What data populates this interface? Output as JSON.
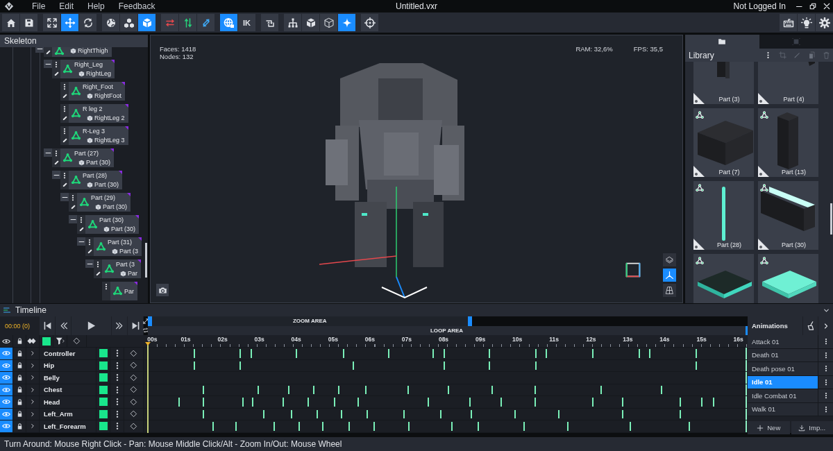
{
  "window": {
    "title": "Untitled.vxr",
    "menu": [
      "File",
      "Edit",
      "Help",
      "Feedback"
    ],
    "account": "Not Logged In"
  },
  "toolbar": {
    "groups": [
      [
        {
          "kind": "home",
          "selected": false
        },
        {
          "kind": "save",
          "selected": false
        }
      ],
      [
        {
          "kind": "fit",
          "selected": false
        },
        {
          "kind": "move",
          "selected": true
        },
        {
          "kind": "rotate",
          "selected": false
        }
      ],
      [
        {
          "kind": "globe",
          "selected": false
        },
        {
          "kind": "nodes",
          "selected": false
        },
        {
          "kind": "cube",
          "selected": true
        }
      ],
      [
        {
          "kind": "swap",
          "selected": false
        },
        {
          "kind": "updown",
          "selected": false
        },
        {
          "kind": "swapdiag",
          "selected": false
        }
      ],
      [
        {
          "kind": "globelink",
          "selected": true
        },
        {
          "kind": "text",
          "label": "IK",
          "selected": false
        }
      ],
      [
        {
          "kind": "rotatebox",
          "selected": false
        }
      ],
      [
        {
          "kind": "hierarchy",
          "selected": false
        },
        {
          "kind": "cubesolid",
          "selected": false
        },
        {
          "kind": "cubeoutline",
          "selected": false
        },
        {
          "kind": "sparkle",
          "selected": true
        }
      ],
      [
        {
          "kind": "crosshair",
          "selected": false
        }
      ]
    ],
    "right": [
      {
        "kind": "keyboard"
      },
      {
        "kind": "bulb"
      },
      {
        "kind": "gear"
      }
    ]
  },
  "skeleton": {
    "title": "Skeleton",
    "nodes": [
      {
        "mesh": "RightThigh",
        "expanded": true,
        "children": [
          {
            "name": "Right_Leg",
            "mesh": "RightLeg",
            "expanded": true,
            "children": [
              {
                "name": "Right_Foot",
                "mesh": "RightFoot"
              },
              {
                "name": "R leg 2",
                "mesh": "RightLeg 2"
              },
              {
                "name": "R-Leg 3",
                "mesh": "RightLeg 3"
              }
            ]
          },
          {
            "name": "Part (27)",
            "mesh": "Part (30)",
            "expanded": true,
            "children": [
              {
                "name": "Part (28)",
                "mesh": "Part (30)",
                "expanded": true,
                "children": [
                  {
                    "name": "Part (29)",
                    "mesh": "Part (30)",
                    "expanded": true,
                    "children": [
                      {
                        "name": "Part (30)",
                        "mesh": "Part (30)",
                        "expanded": true,
                        "children": [
                          {
                            "name": "Part (31)",
                            "mesh": "Part (3",
                            "expanded": true,
                            "children": [
                              {
                                "name": "Part (3",
                                "mesh": "Par",
                                "expanded": true,
                                "children": [
                                  {
                                    "name": "Par"
                                  }
                                ]
                              }
                            ]
                          }
                        ]
                      }
                    ]
                  }
                ]
              }
            ]
          }
        ]
      }
    ]
  },
  "viewport": {
    "faces": "Faces: 1418",
    "nodes": "Nodes: 132",
    "ram": "RAM: 32,6%",
    "fps": "FPS: 35,5",
    "side_buttons": [
      {
        "kind": "layers",
        "selected": false
      },
      {
        "kind": "axes",
        "selected": true
      },
      {
        "kind": "perspective",
        "selected": false
      }
    ]
  },
  "library": {
    "title": "Library",
    "tabs": [
      {
        "kind": "folder",
        "selected": true
      },
      {
        "kind": "frame",
        "selected": false
      }
    ],
    "items": [
      {
        "kind": "post",
        "label": "Part (3)",
        "bone": false
      },
      {
        "kind": "glow-bar",
        "label": "Part (4)",
        "bone": false
      },
      {
        "kind": "box",
        "label": "Part (7)",
        "bone": true
      },
      {
        "kind": "pillar",
        "label": "Part (13)",
        "bone": true
      },
      {
        "kind": "glow-rod",
        "label": "Part (28)",
        "bone": true
      },
      {
        "kind": "glow-block",
        "label": "Part (30)",
        "bone": true
      },
      {
        "kind": "plate-dark",
        "bone": true
      },
      {
        "kind": "plate-glow",
        "bone": true
      }
    ]
  },
  "timeline": {
    "title": "Timeline",
    "time": "00:00 (0)",
    "zoom": {
      "label": "ZOOM AREA",
      "level": 0.54
    },
    "loop": {
      "label": "LOOP AREA",
      "level": 1
    },
    "ticks": [
      "00s",
      "01s",
      "02s",
      "03s",
      "04s",
      "05s",
      "06s",
      "07s",
      "08s",
      "09s",
      "10s",
      "11s",
      "12s",
      "13s",
      "14s",
      "15s",
      "16s"
    ],
    "tracks": [
      {
        "name": "Controller",
        "visible": true,
        "keys": [
          {
            "level": 0.078
          },
          {
            "level": 0.154
          },
          {
            "level": 0.173
          },
          {
            "level": 0.249
          },
          {
            "level": 0.327
          },
          {
            "level": 0.403
          },
          {
            "level": 0.477
          },
          {
            "level": 0.496
          },
          {
            "level": 0.572
          },
          {
            "level": 0.649
          },
          {
            "level": 0.667
          },
          {
            "level": 0.744
          },
          {
            "level": 0.822
          },
          {
            "level": 0.84
          },
          {
            "level": 0.917
          }
        ]
      },
      {
        "name": "Hip",
        "visible": true,
        "keys": [
          {
            "level": 0.078
          },
          {
            "level": 0.154
          },
          {
            "level": 0.344
          },
          {
            "level": 0.496
          },
          {
            "level": 0.572
          },
          {
            "level": 0.649
          },
          {
            "level": 0.917
          }
        ]
      },
      {
        "name": "Belly",
        "visible": true
      },
      {
        "name": "Chest",
        "visible": true,
        "keys": [
          {
            "level": 0.093
          },
          {
            "level": 0.185
          },
          {
            "level": 0.236
          },
          {
            "level": 0.278
          },
          {
            "level": 0.319
          },
          {
            "level": 0.365
          },
          {
            "level": 0.435
          },
          {
            "level": 0.503
          },
          {
            "level": 0.576
          },
          {
            "level": 0.648
          },
          {
            "level": 0.758
          },
          {
            "level": 0.86
          }
        ]
      },
      {
        "name": "Head",
        "visible": true,
        "keys": [
          {
            "level": 0.052
          },
          {
            "level": 0.093
          },
          {
            "level": 0.159
          },
          {
            "level": 0.175
          },
          {
            "level": 0.227
          },
          {
            "level": 0.268
          },
          {
            "level": 0.312
          },
          {
            "level": 0.352
          },
          {
            "level": 0.469
          },
          {
            "level": 0.539
          },
          {
            "level": 0.591
          },
          {
            "level": 0.648
          },
          {
            "level": 0.744
          },
          {
            "level": 0.794
          },
          {
            "level": 0.891
          },
          {
            "level": 0.927
          },
          {
            "level": 0.946
          }
        ]
      },
      {
        "name": "Left_Arm",
        "visible": true,
        "keys": [
          {
            "level": 0.093
          },
          {
            "level": 0.194
          },
          {
            "level": 0.24
          },
          {
            "level": 0.283
          },
          {
            "level": 0.324
          },
          {
            "level": 0.367
          },
          {
            "level": 0.429
          },
          {
            "level": 0.49
          },
          {
            "level": 0.541
          },
          {
            "level": 0.614
          },
          {
            "level": 0.688
          },
          {
            "level": 0.794
          },
          {
            "level": 0.891
          }
        ]
      },
      {
        "name": "Left_Forearm",
        "visible": true,
        "keys": [
          {
            "level": 0.109
          },
          {
            "level": 0.147
          },
          {
            "level": 0.211
          },
          {
            "level": 0.253
          },
          {
            "level": 0.293
          },
          {
            "level": 0.337
          },
          {
            "level": 0.379
          },
          {
            "level": 0.437
          },
          {
            "level": 0.509
          },
          {
            "level": 0.553
          },
          {
            "level": 0.629
          },
          {
            "level": 0.703
          },
          {
            "level": 0.807
          },
          {
            "level": 0.906
          }
        ]
      }
    ]
  },
  "animations": {
    "title": "Animations",
    "items": [
      {
        "name": "Attack 01",
        "selected": false
      },
      {
        "name": "Death 01",
        "selected": false
      },
      {
        "name": "Death pose 01",
        "selected": false
      },
      {
        "name": "Idle 01",
        "selected": true
      },
      {
        "name": "Idle Combat 01",
        "selected": false
      },
      {
        "name": "Walk 01",
        "selected": false
      }
    ],
    "buttons": [
      {
        "kind": "new",
        "label": "New"
      },
      {
        "kind": "import",
        "label": "Imp..."
      }
    ]
  },
  "status_bar": "Turn Around: Mouse Right Click - Pan: Mouse Middle Click/Alt - Zoom In/Out: Mouse Wheel"
}
